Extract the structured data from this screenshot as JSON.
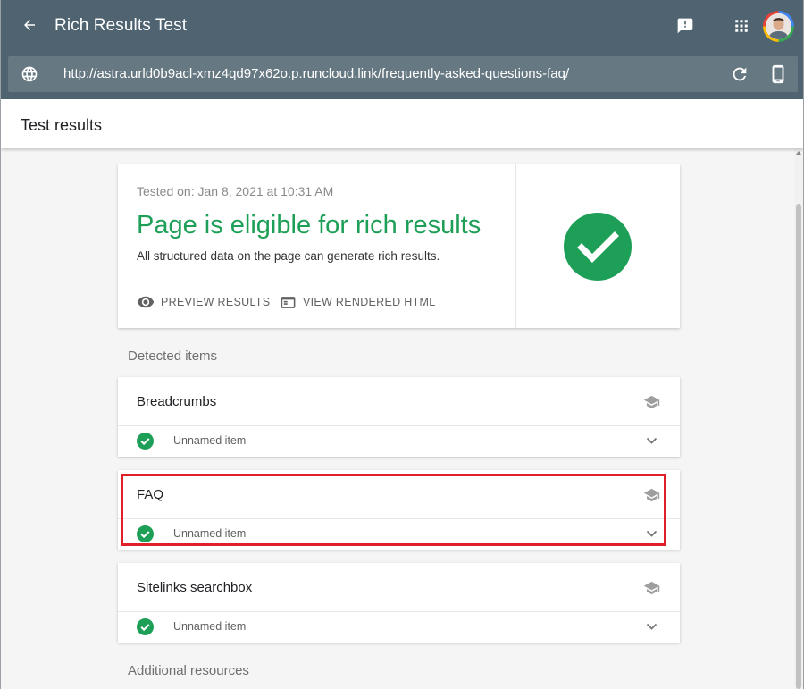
{
  "app": {
    "title": "Rich Results Test",
    "url": "http://astra.urld0b9acl-xmz4qd97x62o.p.runcloud.link/frequently-asked-questions-faq/"
  },
  "results": {
    "title": "Test results"
  },
  "summary": {
    "tested_on": "Tested on: Jan 8, 2021 at 10:31 AM",
    "headline": "Page is eligible for rich results",
    "subtext": "All structured data on the page can generate rich results.",
    "preview_label": "PREVIEW RESULTS",
    "rendered_label": "VIEW RENDERED HTML"
  },
  "detected": {
    "label": "Detected items",
    "items": [
      {
        "title": "Breadcrumbs",
        "row": "Unnamed item"
      },
      {
        "title": "FAQ",
        "row": "Unnamed item"
      },
      {
        "title": "Sitelinks searchbox",
        "row": "Unnamed item"
      }
    ]
  },
  "additional": {
    "label": "Additional resources"
  },
  "colors": {
    "topbar": "#4f6470",
    "urlbar": "#667882",
    "success_green": "#1e9f57",
    "highlight_red": "#e01f26"
  },
  "icons": [
    "back-arrow-icon",
    "feedback-icon",
    "apps-grid-icon",
    "globe-icon",
    "reload-icon",
    "mobile-device-icon",
    "eye-icon",
    "browser-window-icon",
    "check-circle-icon",
    "graduation-cap-icon",
    "chevron-down-icon"
  ]
}
